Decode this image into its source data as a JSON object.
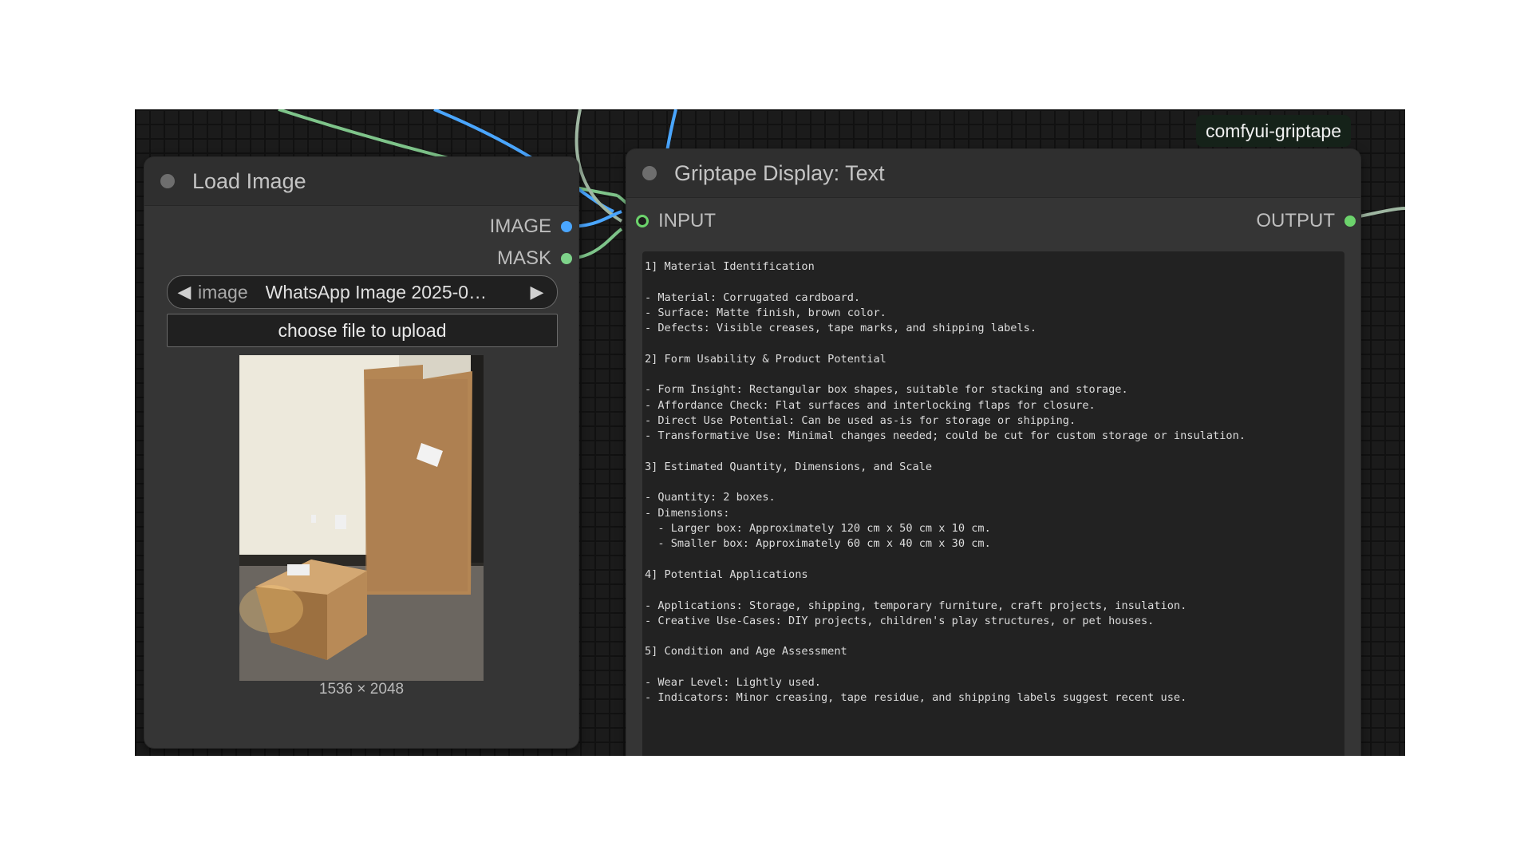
{
  "badge": "comfyui-griptape",
  "colors": {
    "image_link": "#4aa6ff",
    "mask_link": "#7ec48a",
    "string_link": "#9fb7a2",
    "mask_dot": "#7ed38a",
    "input_dot": "#6cd36c"
  },
  "load_image": {
    "title": "Load Image",
    "outputs": [
      {
        "label": "IMAGE",
        "color": "#4aa6ff"
      },
      {
        "label": "MASK",
        "color": "#7ed38a"
      }
    ],
    "image_widget": {
      "name": "image",
      "value": "WhatsApp Image 2025-0…"
    },
    "upload_label": "choose file to upload",
    "preview_size": "1536 × 2048"
  },
  "display_text": {
    "title": "Griptape Display: Text",
    "input_label": "INPUT",
    "output_label": "OUTPUT",
    "text": "1] Material Identification\n\n- Material: Corrugated cardboard.\n- Surface: Matte finish, brown color.\n- Defects: Visible creases, tape marks, and shipping labels.\n\n2] Form Usability & Product Potential\n\n- Form Insight: Rectangular box shapes, suitable for stacking and storage.\n- Affordance Check: Flat surfaces and interlocking flaps for closure.\n- Direct Use Potential: Can be used as-is for storage or shipping.\n- Transformative Use: Minimal changes needed; could be cut for custom storage or insulation.\n\n3] Estimated Quantity, Dimensions, and Scale\n\n- Quantity: 2 boxes.\n- Dimensions:\n  - Larger box: Approximately 120 cm x 50 cm x 10 cm.\n  - Smaller box: Approximately 60 cm x 40 cm x 30 cm.\n\n4] Potential Applications\n\n- Applications: Storage, shipping, temporary furniture, craft projects, insulation.\n- Creative Use-Cases: DIY projects, children's play structures, or pet houses.\n\n5] Condition and Age Assessment\n\n- Wear Level: Lightly used.\n- Indicators: Minor creasing, tape residue, and shipping labels suggest recent use."
  }
}
